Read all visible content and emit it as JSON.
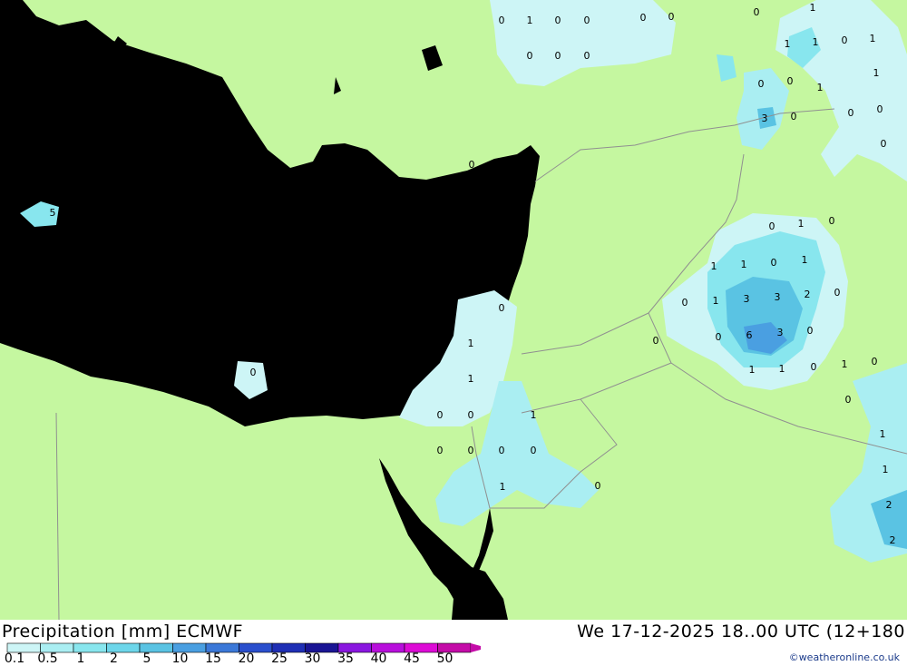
{
  "header": {
    "title": "Precipitation [mm] ECMWF",
    "datetime": "We 17-12-2025 18..00 UTC (12+180",
    "credit": "©weatheronline.co.uk"
  },
  "legend": {
    "labels": [
      "0.1",
      "0.5",
      "1",
      "2",
      "5",
      "10",
      "15",
      "20",
      "25",
      "30",
      "35",
      "40",
      "45",
      "50"
    ],
    "colors": [
      "#cdf5f6",
      "#aaeef2",
      "#88e6ee",
      "#6dd6ea",
      "#5ac3e3",
      "#4a9fe1",
      "#3b78d8",
      "#2a4fcd",
      "#1f2fb5",
      "#1a1594",
      "#8a17e0",
      "#b80fdc",
      "#dd0bd6",
      "#c40ca8"
    ]
  },
  "map": {
    "land_color": "#c5f7a0",
    "sea_color": "#e8e8e8",
    "values": [
      "0",
      "1",
      "0",
      "0",
      "0",
      "0",
      "0",
      "0",
      "0",
      "0",
      "1",
      "1",
      "1",
      "0",
      "1",
      "1",
      "0",
      "0",
      "1",
      "0",
      "3",
      "0",
      "0",
      "0",
      "0",
      "0",
      "5",
      "0",
      "0",
      "0",
      "0",
      "1",
      "0",
      "1",
      "0",
      "1",
      "1",
      "0",
      "1",
      "3",
      "3",
      "2",
      "0",
      "0",
      "0",
      "6",
      "3",
      "0",
      "1",
      "1",
      "1",
      "0",
      "0",
      "1",
      "0",
      "0",
      "0",
      "0",
      "0",
      "0",
      "1",
      "1",
      "0",
      "1",
      "1",
      "0",
      "0",
      "2",
      "2",
      "1"
    ]
  }
}
